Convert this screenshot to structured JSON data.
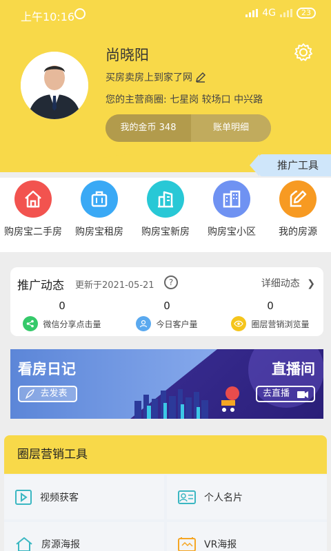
{
  "status_bar": {
    "time": "上午10:16",
    "network": "4G",
    "battery": "23"
  },
  "profile": {
    "name": "尚晓阳",
    "slogan": "买房卖房上到家了网",
    "districts": "您的主营商圈: 七星岗  较场口  中兴路",
    "coins_label": "我的金币 348",
    "bill_label": "账单明细"
  },
  "promo_tag": "推广工具",
  "shortcuts": [
    {
      "label": "购房宝二手房",
      "color": "#f2534f",
      "icon": "house-icon"
    },
    {
      "label": "购房宝租房",
      "color": "#3aa9f5",
      "icon": "suitcase-icon"
    },
    {
      "label": "购房宝新房",
      "color": "#28c8d6",
      "icon": "building-icon"
    },
    {
      "label": "购房宝小区",
      "color": "#6f92f2",
      "icon": "community-icon"
    },
    {
      "label": "我的房源",
      "color": "#f79a22",
      "icon": "edit-icon"
    }
  ],
  "stats_card": {
    "title": "推广动态",
    "updated": "更新于2021-05-21",
    "detail_link": "详细动态",
    "items": [
      {
        "value": "0",
        "label": "微信分享点击量",
        "color": "#35c96a",
        "icon": "share-icon"
      },
      {
        "value": "0",
        "label": "今日客户量",
        "color": "#5aa9ef",
        "icon": "user-icon"
      },
      {
        "value": "0",
        "label": "圈层营销浏览量",
        "color": "#f5c51c",
        "icon": "eye-icon"
      }
    ]
  },
  "banner": {
    "left_title": "看房日记",
    "left_button": "去发表",
    "right_title": "直播间",
    "right_button": "去直播"
  },
  "marketing": {
    "title": "圈层营销工具",
    "tools": [
      {
        "label": "视频获客",
        "icon": "video-icon"
      },
      {
        "label": "个人名片",
        "icon": "card-icon"
      },
      {
        "label": "房源海报",
        "icon": "house-outline-icon"
      },
      {
        "label": "VR海报",
        "icon": "vr-icon"
      }
    ]
  }
}
